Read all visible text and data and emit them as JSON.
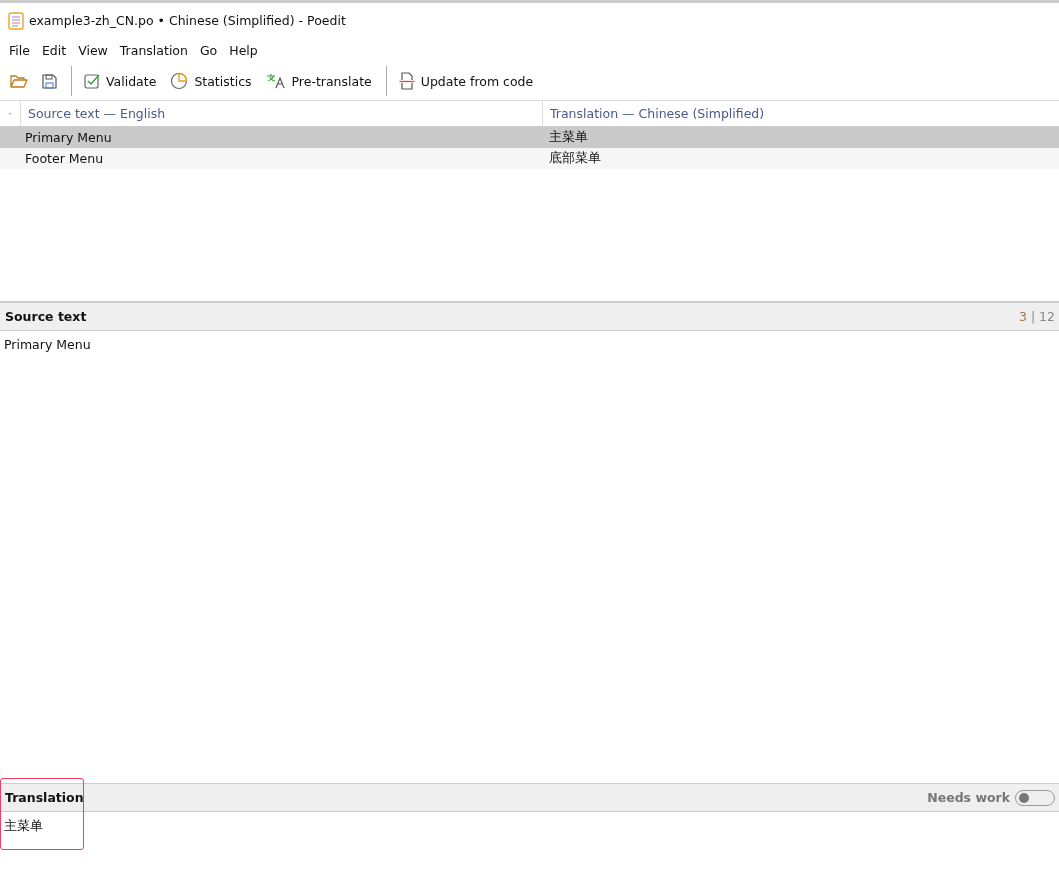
{
  "window": {
    "title": "example3-zh_CN.po • Chinese (Simplified) - Poedit"
  },
  "menu": [
    "File",
    "Edit",
    "View",
    "Translation",
    "Go",
    "Help"
  ],
  "toolbar": [
    {
      "kind": "open"
    },
    {
      "kind": "save"
    },
    {
      "kind": "separator"
    },
    {
      "kind": "validate",
      "label": "Validate"
    },
    {
      "kind": "statistics",
      "label": "Statistics"
    },
    {
      "kind": "pretranslate",
      "label": "Pre-translate"
    },
    {
      "kind": "separator"
    },
    {
      "kind": "update",
      "label": "Update from code"
    }
  ],
  "table": {
    "marker": "·",
    "columns": [
      "Source text — English",
      "Translation — Chinese (Simplified)"
    ],
    "rows": [
      {
        "source": "Primary Menu",
        "translation": "主菜单",
        "selected": true
      },
      {
        "source": "Footer Menu",
        "translation": "底部菜单",
        "selected": false
      }
    ]
  },
  "source_panel": {
    "title": "Source text",
    "counter_current": "3",
    "counter_separator": "|",
    "counter_total": "12",
    "text": "Primary Menu"
  },
  "translation_panel": {
    "title": "Translation",
    "needs_work_label": "Needs work",
    "needs_work": false,
    "text": "主菜单",
    "highlighted": true
  }
}
